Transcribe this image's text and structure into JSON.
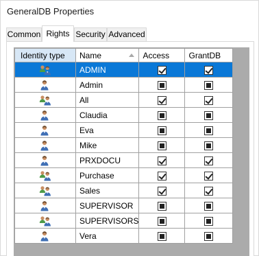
{
  "window": {
    "title": "GeneralDB Properties"
  },
  "tabs": [
    {
      "label": "Common",
      "active": false
    },
    {
      "label": "Rights",
      "active": true
    },
    {
      "label": "Security",
      "active": false
    },
    {
      "label": "Advanced",
      "active": false
    }
  ],
  "grid": {
    "columns": [
      "Identity type",
      "Name",
      "Access",
      "GrantDB"
    ],
    "sort_column": "Name",
    "sort_direction": "ascending",
    "rows": [
      {
        "type": "group-icon",
        "name": "ADMIN",
        "access": "checked",
        "grantdb": "checked",
        "selected": true
      },
      {
        "type": "user-icon",
        "name": "Admin",
        "access": "indeterminate",
        "grantdb": "indeterminate",
        "selected": false
      },
      {
        "type": "group-icon",
        "name": "All",
        "access": "checked",
        "grantdb": "checked",
        "selected": false
      },
      {
        "type": "user-icon",
        "name": "Claudia",
        "access": "indeterminate",
        "grantdb": "indeterminate",
        "selected": false
      },
      {
        "type": "user-icon",
        "name": "Eva",
        "access": "indeterminate",
        "grantdb": "indeterminate",
        "selected": false
      },
      {
        "type": "user-icon",
        "name": "Mike",
        "access": "indeterminate",
        "grantdb": "indeterminate",
        "selected": false
      },
      {
        "type": "user-icon",
        "name": "PRXDOCU",
        "access": "checked",
        "grantdb": "checked",
        "selected": false
      },
      {
        "type": "group-icon",
        "name": "Purchase",
        "access": "checked",
        "grantdb": "checked",
        "selected": false
      },
      {
        "type": "group-icon",
        "name": "Sales",
        "access": "checked",
        "grantdb": "checked",
        "selected": false
      },
      {
        "type": "user-icon",
        "name": "SUPERVISOR",
        "access": "indeterminate",
        "grantdb": "indeterminate",
        "selected": false
      },
      {
        "type": "group-icon",
        "name": "SUPERVISORS",
        "access": "indeterminate",
        "grantdb": "indeterminate",
        "selected": false
      },
      {
        "type": "user-icon",
        "name": "Vera",
        "access": "indeterminate",
        "grantdb": "indeterminate",
        "selected": false
      }
    ]
  },
  "colors": {
    "selection": "#0a78d7",
    "header_highlight": "#d7e7f6",
    "grid_background": "#ababab"
  }
}
